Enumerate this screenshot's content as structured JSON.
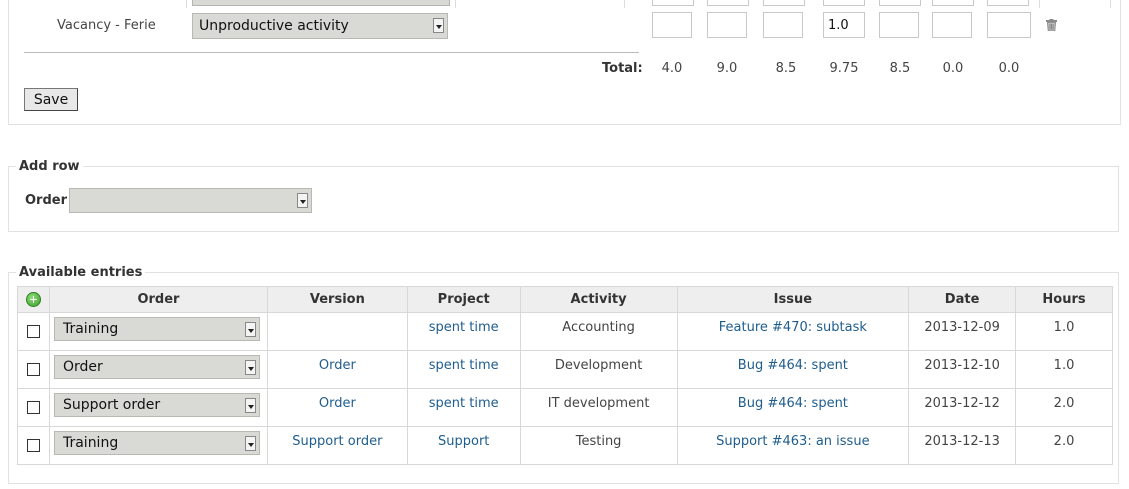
{
  "timesheet": {
    "row_label": "Vacancy - Ferie",
    "activity_select": "Unproductive activity",
    "hours": [
      "",
      "",
      "",
      "1.0",
      "",
      "",
      ""
    ],
    "total_label": "Total:",
    "totals": [
      "4.0",
      "9.0",
      "8.5",
      "9.75",
      "8.5",
      "0.0",
      "0.0"
    ],
    "save_label": "Save"
  },
  "add_row": {
    "legend": "Add row",
    "order_label": "Order",
    "order_value": ""
  },
  "available": {
    "legend": "Available entries",
    "headers": [
      "Order",
      "Version",
      "Project",
      "Activity",
      "Issue",
      "Date",
      "Hours"
    ],
    "rows": [
      {
        "order": "Training",
        "version": "",
        "project": "spent time",
        "activity": "Accounting",
        "issue": "Feature #470: subtask",
        "date": "2013-12-09",
        "hours": "1.0"
      },
      {
        "order": "Order",
        "version": "Order",
        "project": "spent time",
        "activity": "Development",
        "issue": "Bug #464: spent",
        "date": "2013-12-10",
        "hours": "1.0"
      },
      {
        "order": "Support order",
        "version": "Order",
        "project": "spent time",
        "activity": "IT development",
        "issue": "Bug #464: spent",
        "date": "2013-12-12",
        "hours": "2.0"
      },
      {
        "order": "Training",
        "version": "Support order",
        "project": "Support",
        "activity": "Testing",
        "issue": "Support #463: an issue",
        "date": "2013-12-13",
        "hours": "2.0"
      }
    ]
  },
  "colors": {
    "link": "#1e5d8e",
    "border": "#d8d8d8",
    "header_bg": "#eeeeee",
    "select_bg": "#d9d9d5"
  },
  "icons": [
    "trash-icon",
    "add-circle-icon",
    "dropdown-arrow-icon"
  ]
}
